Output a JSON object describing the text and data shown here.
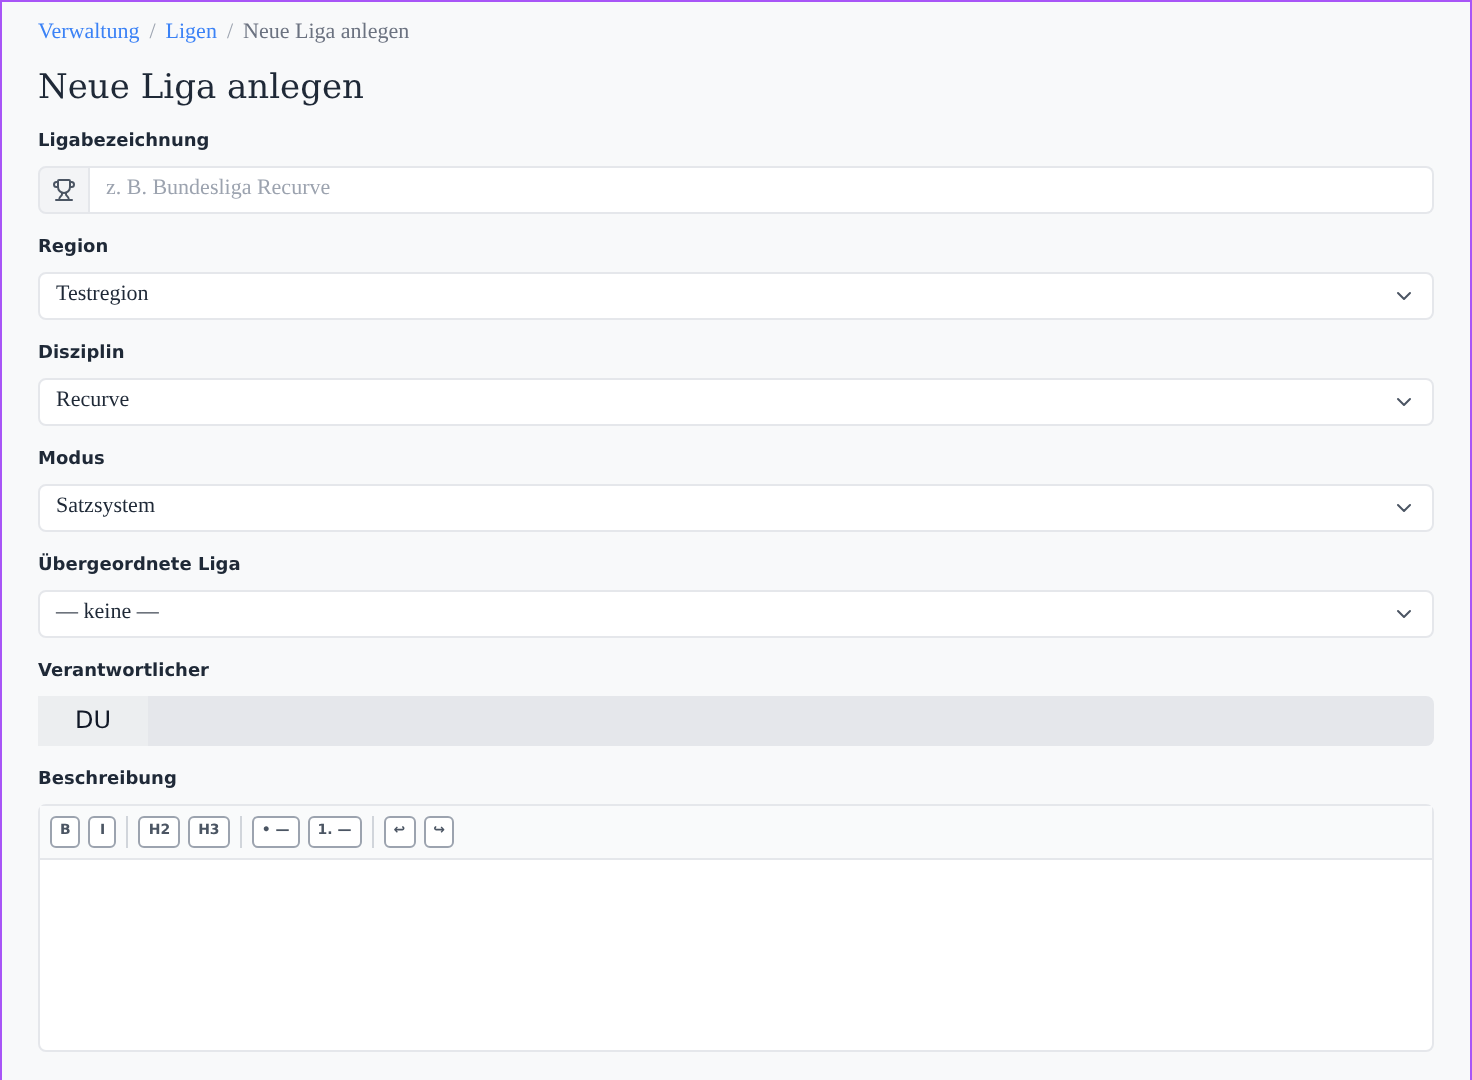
{
  "breadcrumb": [
    {
      "label": "Verwaltung",
      "kind": "link"
    },
    {
      "label": "Ligen",
      "kind": "link"
    },
    {
      "label": "Neue Liga anlegen",
      "kind": "current"
    }
  ],
  "breadcrumb_separator": "/",
  "title": "Neue Liga anlegen",
  "fields": [
    {
      "kind": "text",
      "label": "Ligabezeichnung",
      "placeholder": "z. B. Bundesliga Recurve"
    },
    {
      "kind": "select",
      "label": "Region",
      "value": "Testregion"
    },
    {
      "kind": "select",
      "label": "Disziplin",
      "value": "Recurve"
    },
    {
      "kind": "select",
      "label": "Modus",
      "value": "Satzsystem"
    },
    {
      "kind": "select",
      "label": "Übergeordnete Liga",
      "value": "— keine —"
    },
    {
      "kind": "readonly",
      "label": "Verantwortlicher",
      "value": "DU"
    },
    {
      "kind": "editor",
      "label": "Beschreibung",
      "toolbar": [
        [
          "B",
          "I"
        ],
        [
          "H2",
          "H3"
        ],
        [
          "• —",
          "1. —"
        ],
        [
          "↩",
          "↪"
        ]
      ]
    }
  ]
}
